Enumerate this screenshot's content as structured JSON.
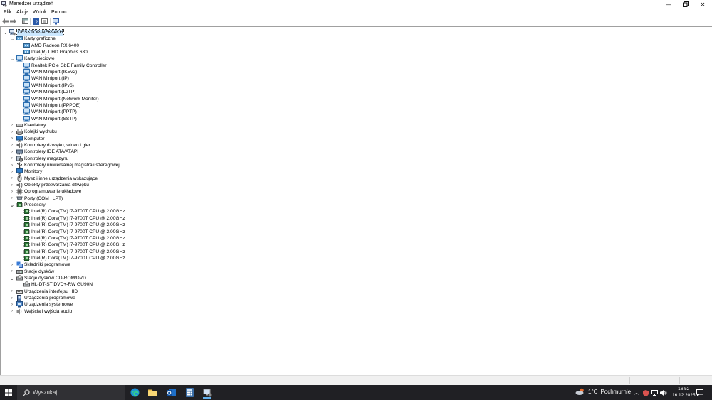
{
  "window": {
    "title": "Menedżer urządzeń"
  },
  "menu": [
    "Plik",
    "Akcja",
    "Widok",
    "Pomoc"
  ],
  "tree": [
    {
      "label": "DESKTOP-NFK94KH",
      "level": 0,
      "expand": "open",
      "icon": "computer-icon",
      "selected": true
    },
    {
      "label": "Karty graficzne",
      "level": 1,
      "expand": "open",
      "icon": "display-adapter-icon"
    },
    {
      "label": "AMD Radeon RX 6400",
      "level": 2,
      "expand": "none",
      "icon": "display-adapter-icon"
    },
    {
      "label": "Intel(R) UHD Graphics 630",
      "level": 2,
      "expand": "none",
      "icon": "display-adapter-icon"
    },
    {
      "label": "Karty sieciowe",
      "level": 1,
      "expand": "open",
      "icon": "network-adapter-icon"
    },
    {
      "label": "Realtek PCIe GbE Family Controller",
      "level": 2,
      "expand": "none",
      "icon": "network-adapter-icon"
    },
    {
      "label": "WAN Miniport (IKEv2)",
      "level": 2,
      "expand": "none",
      "icon": "network-adapter-icon"
    },
    {
      "label": "WAN Miniport (IP)",
      "level": 2,
      "expand": "none",
      "icon": "network-adapter-icon"
    },
    {
      "label": "WAN Miniport (IPv6)",
      "level": 2,
      "expand": "none",
      "icon": "network-adapter-icon"
    },
    {
      "label": "WAN Miniport (L2TP)",
      "level": 2,
      "expand": "none",
      "icon": "network-adapter-icon"
    },
    {
      "label": "WAN Miniport (Network Monitor)",
      "level": 2,
      "expand": "none",
      "icon": "network-adapter-icon"
    },
    {
      "label": "WAN Miniport (PPPOE)",
      "level": 2,
      "expand": "none",
      "icon": "network-adapter-icon"
    },
    {
      "label": "WAN Miniport (PPTP)",
      "level": 2,
      "expand": "none",
      "icon": "network-adapter-icon"
    },
    {
      "label": "WAN Miniport (SSTP)",
      "level": 2,
      "expand": "none",
      "icon": "network-adapter-icon"
    },
    {
      "label": "Klawiatury",
      "level": 1,
      "expand": "closed",
      "icon": "keyboard-icon"
    },
    {
      "label": "Kolejki wydruku",
      "level": 1,
      "expand": "closed",
      "icon": "printer-icon"
    },
    {
      "label": "Komputer",
      "level": 1,
      "expand": "closed",
      "icon": "monitor-icon"
    },
    {
      "label": "Kontrolery dźwięku, wideo i gier",
      "level": 1,
      "expand": "closed",
      "icon": "audio-icon"
    },
    {
      "label": "Kontrolery IDE ATA/ATAPI",
      "level": 1,
      "expand": "closed",
      "icon": "ide-controller-icon"
    },
    {
      "label": "Kontrolery magazynu",
      "level": 1,
      "expand": "closed",
      "icon": "storage-controller-icon"
    },
    {
      "label": "Kontrolery uniwersalnej magistrali szeregowej",
      "level": 1,
      "expand": "closed",
      "icon": "usb-icon"
    },
    {
      "label": "Monitory",
      "level": 1,
      "expand": "closed",
      "icon": "monitor-icon"
    },
    {
      "label": "Mysz i inne urządzenia wskazujące",
      "level": 1,
      "expand": "closed",
      "icon": "mouse-icon"
    },
    {
      "label": "Obiekty przetwarzania dźwięku",
      "level": 1,
      "expand": "closed",
      "icon": "audio-icon"
    },
    {
      "label": "Oprogramowanie układowe",
      "level": 1,
      "expand": "closed",
      "icon": "firmware-icon"
    },
    {
      "label": "Porty (COM i LPT)",
      "level": 1,
      "expand": "closed",
      "icon": "port-icon"
    },
    {
      "label": "Procesory",
      "level": 1,
      "expand": "open",
      "icon": "processor-icon"
    },
    {
      "label": "Intel(R) Core(TM) i7-9700T CPU @ 2.00GHz",
      "level": 2,
      "expand": "none",
      "icon": "processor-icon"
    },
    {
      "label": "Intel(R) Core(TM) i7-9700T CPU @ 2.00GHz",
      "level": 2,
      "expand": "none",
      "icon": "processor-icon"
    },
    {
      "label": "Intel(R) Core(TM) i7-9700T CPU @ 2.00GHz",
      "level": 2,
      "expand": "none",
      "icon": "processor-icon"
    },
    {
      "label": "Intel(R) Core(TM) i7-9700T CPU @ 2.00GHz",
      "level": 2,
      "expand": "none",
      "icon": "processor-icon"
    },
    {
      "label": "Intel(R) Core(TM) i7-9700T CPU @ 2.00GHz",
      "level": 2,
      "expand": "none",
      "icon": "processor-icon"
    },
    {
      "label": "Intel(R) Core(TM) i7-9700T CPU @ 2.00GHz",
      "level": 2,
      "expand": "none",
      "icon": "processor-icon"
    },
    {
      "label": "Intel(R) Core(TM) i7-9700T CPU @ 2.00GHz",
      "level": 2,
      "expand": "none",
      "icon": "processor-icon"
    },
    {
      "label": "Intel(R) Core(TM) i7-9700T CPU @ 2.00GHz",
      "level": 2,
      "expand": "none",
      "icon": "processor-icon"
    },
    {
      "label": "Składniki programowe",
      "level": 1,
      "expand": "closed",
      "icon": "software-component-icon"
    },
    {
      "label": "Stacje dysków",
      "level": 1,
      "expand": "closed",
      "icon": "disk-drive-icon"
    },
    {
      "label": "Stacje dysków CD-ROM/DVD",
      "level": 1,
      "expand": "open",
      "icon": "dvd-drive-icon"
    },
    {
      "label": "HL-DT-ST DVD+-RW GU90N",
      "level": 2,
      "expand": "none",
      "icon": "dvd-drive-icon"
    },
    {
      "label": "Urządzenia interfejsu HID",
      "level": 1,
      "expand": "closed",
      "icon": "hid-icon"
    },
    {
      "label": "Urządzenia programowe",
      "level": 1,
      "expand": "closed",
      "icon": "software-device-icon"
    },
    {
      "label": "Urządzenia systemowe",
      "level": 1,
      "expand": "closed",
      "icon": "system-device-icon"
    },
    {
      "label": "Wejścia i wyjścia audio",
      "level": 1,
      "expand": "closed",
      "icon": "audio-io-icon"
    }
  ],
  "taskbar": {
    "search_placeholder": "Wyszukaj",
    "weather": {
      "temp": "1°C",
      "desc": "Pochmurnie"
    },
    "clock": {
      "time": "16:52",
      "date": "16.12.2025"
    }
  },
  "colors": {
    "accent": "#0078d4",
    "selection": "#cce8ff",
    "taskbar": "#202024"
  }
}
